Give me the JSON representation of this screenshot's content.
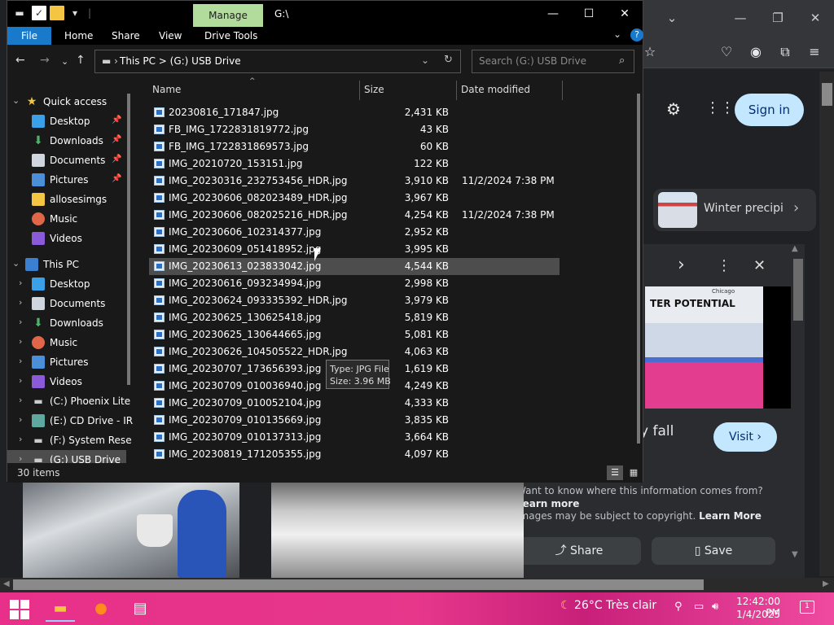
{
  "explorer": {
    "title": "G:\\",
    "manage_label": "Manage",
    "ribbon_tabs": {
      "file": "File",
      "home": "Home",
      "share": "Share",
      "view": "View",
      "drive_tools": "Drive Tools"
    },
    "address": {
      "parts": "This PC  >  (G:) USB Drive"
    },
    "search_placeholder": "Search (G:) USB Drive",
    "columns": {
      "name": "Name",
      "size": "Size",
      "date": "Date modified"
    },
    "nav": {
      "quick_access": "Quick access",
      "qa_desktop": "Desktop",
      "qa_downloads": "Downloads",
      "qa_documents": "Documents",
      "qa_pictures": "Pictures",
      "qa_allosesimgs": "allosesimgs",
      "qa_music": "Music",
      "qa_videos": "Videos",
      "this_pc": "This PC",
      "pc_desktop": "Desktop",
      "pc_documents": "Documents",
      "pc_downloads": "Downloads",
      "pc_music": "Music",
      "pc_pictures": "Pictures",
      "pc_videos": "Videos",
      "drive_c": "(C:) Phoenix Lite",
      "drive_e": "(E:) CD Drive - IR",
      "drive_f": "(F:) System Rese",
      "drive_g": "(G:) USB Drive"
    },
    "files": [
      {
        "name": "20230816_171847.jpg",
        "size": "2,431 KB",
        "date": ""
      },
      {
        "name": "FB_IMG_1722831819772.jpg",
        "size": "43 KB",
        "date": ""
      },
      {
        "name": "FB_IMG_1722831869573.jpg",
        "size": "60 KB",
        "date": ""
      },
      {
        "name": "IMG_20210720_153151.jpg",
        "size": "122 KB",
        "date": ""
      },
      {
        "name": "IMG_20230316_232753456_HDR.jpg",
        "size": "3,910 KB",
        "date": "11/2/2024 7:38 PM"
      },
      {
        "name": "IMG_20230606_082023489_HDR.jpg",
        "size": "3,967 KB",
        "date": ""
      },
      {
        "name": "IMG_20230606_082025216_HDR.jpg",
        "size": "4,254 KB",
        "date": "11/2/2024 7:38 PM"
      },
      {
        "name": "IMG_20230606_102314377.jpg",
        "size": "2,952 KB",
        "date": ""
      },
      {
        "name": "IMG_20230609_051418952.jpg",
        "size": "3,995 KB",
        "date": ""
      },
      {
        "name": "IMG_20230613_023833042.jpg",
        "size": "4,544 KB",
        "date": ""
      },
      {
        "name": "IMG_20230616_093234994.jpg",
        "size": "2,998 KB",
        "date": ""
      },
      {
        "name": "IMG_20230624_093335392_HDR.jpg",
        "size": "3,979 KB",
        "date": ""
      },
      {
        "name": "IMG_20230625_130625418.jpg",
        "size": "5,819 KB",
        "date": ""
      },
      {
        "name": "IMG_20230625_130644665.jpg",
        "size": "5,081 KB",
        "date": ""
      },
      {
        "name": "IMG_20230626_104505522_HDR.jpg",
        "size": "4,063 KB",
        "date": ""
      },
      {
        "name": "IMG_20230707_173656393.jpg",
        "size": "1,619 KB",
        "date": ""
      },
      {
        "name": "IMG_20230709_010036940.jpg",
        "size": "4,249 KB",
        "date": ""
      },
      {
        "name": "IMG_20230709_010052104.jpg",
        "size": "4,333 KB",
        "date": ""
      },
      {
        "name": "IMG_20230709_010135669.jpg",
        "size": "3,835 KB",
        "date": ""
      },
      {
        "name": "IMG_20230709_010137313.jpg",
        "size": "3,664 KB",
        "date": ""
      },
      {
        "name": "IMG_20230819_171205355.jpg",
        "size": "4,097 KB",
        "date": ""
      }
    ],
    "tooltip": {
      "type": "Type: JPG File",
      "size": "Size: 3.96 MB"
    },
    "status_count": "30 items"
  },
  "browser": {
    "sign_in": "Sign in",
    "winter_card": "Winter precipi",
    "map_title": "TER POTENTIAL",
    "map_city": "Chicago",
    "fall_text": "y fall",
    "visit": "Visit",
    "info_line1_text": "Want to know where this information comes from?",
    "info_line1_link": "Learn more",
    "info_line2_text": "Images may be subject to copyright.",
    "info_line2_link": "Learn More",
    "share": "Share",
    "save": "Save"
  },
  "taskbar": {
    "weather": "26°C  Très clair",
    "time": "12:42:00 PM",
    "date": "1/4/2025",
    "notifications": "1"
  }
}
